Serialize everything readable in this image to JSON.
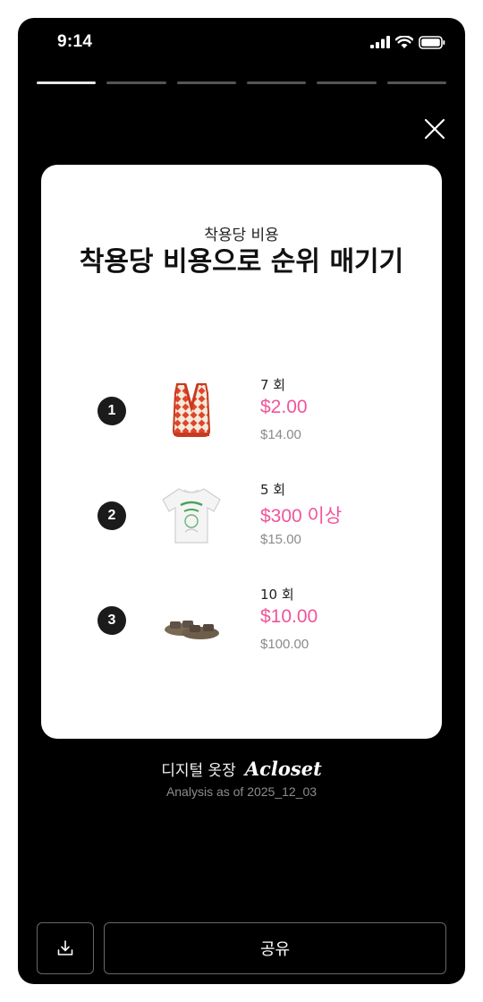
{
  "status_bar": {
    "time": "9:14"
  },
  "story": {
    "segments": 6,
    "active_segment": 1
  },
  "card": {
    "subtitle": "착용당 비용",
    "title": "착용당 비용으로 순위 매기기",
    "items": [
      {
        "rank": "1",
        "wear_count": "7 회",
        "cost_per_wear": "$2.00",
        "price": "$14.00",
        "image": "knit-vest"
      },
      {
        "rank": "2",
        "wear_count": "5 회",
        "cost_per_wear": "$300 이상",
        "price": "$15.00",
        "image": "graphic-tshirt"
      },
      {
        "rank": "3",
        "wear_count": "10 회",
        "cost_per_wear": "$10.00",
        "price": "$100.00",
        "image": "sandals"
      }
    ]
  },
  "footer": {
    "label": "디지털 옷장",
    "brand": "Acloset",
    "analysis_date": "Analysis as of 2025_12_03"
  },
  "actions": {
    "download_icon": "download-icon",
    "share_label": "공유"
  },
  "colors": {
    "background": "#000000",
    "card": "#ffffff",
    "accent_pink": "#f0559b",
    "muted_gray": "#8a8a8a"
  }
}
